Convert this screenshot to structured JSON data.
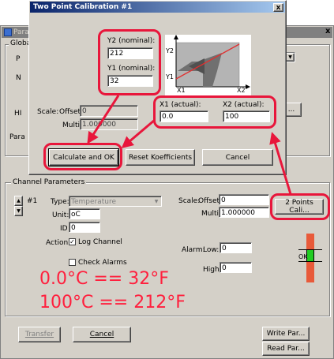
{
  "colors": {
    "accent_red": "#e8163b",
    "title_blue": "#0a246a",
    "dialog_gray": "#d4d0c8"
  },
  "back_window": {
    "title": "Para",
    "close": "x",
    "global_group": {
      "legend": "Globa",
      "p_label": "P",
      "n_label": "N",
      "hi_label": "HI",
      "para_label": "Para",
      "right_button_fragment": "..."
    },
    "channel": {
      "legend": "Channel Parameters",
      "channel_num": "#1",
      "type_label": "Type:",
      "type_value": "Temperature",
      "unit_label": "Unit:",
      "unit_value": "oC",
      "id_label": "ID",
      "id_value": "0",
      "action_label": "Action:",
      "log_channel_label": "Log Channel",
      "check_alarms_label": "Check Alarms",
      "scale_label": "Scale:",
      "offset_label": "Offset:",
      "offset_value": "0",
      "multi_label": "Multi:",
      "multi_value": "1.000000",
      "two_points_button": "2 Points Cali...",
      "alarm_label": "Alarm:",
      "low_label": "Low:",
      "low_value": "0",
      "high_label": "High:",
      "high_value": "0",
      "ok_indicator": "OK"
    },
    "bottom": {
      "transfer_button": "Transfer",
      "cancel_button": "Cancel",
      "write_button": "Write Par...",
      "read_button": "Read Par..."
    }
  },
  "dialog": {
    "title": "Two Point Calibration #1",
    "close": "x",
    "y2_label": "Y2 (nominal):",
    "y2_value": "212",
    "y1_label": "Y1 (nominal):",
    "y1_value": "32",
    "graph": {
      "y2": "Y2",
      "y1": "Y1",
      "x1": "X1",
      "x2": "X2"
    },
    "x1_label": "X1 (actual):",
    "x1_value": "0.0",
    "x2_label": "X2 (actual):",
    "x2_value": "100",
    "scale_label": "Scale:",
    "offset_label": "Offset:",
    "offset_value": "0",
    "multi_label": "Multi:",
    "multi_value": "1.000000",
    "calc_button": "Calculate and OK",
    "reset_button": "Reset Koefficients",
    "cancel_button": "Cancel"
  },
  "annotations": {
    "line1": "0.0°C  == 32°F",
    "line2": "100°C == 212°F"
  }
}
